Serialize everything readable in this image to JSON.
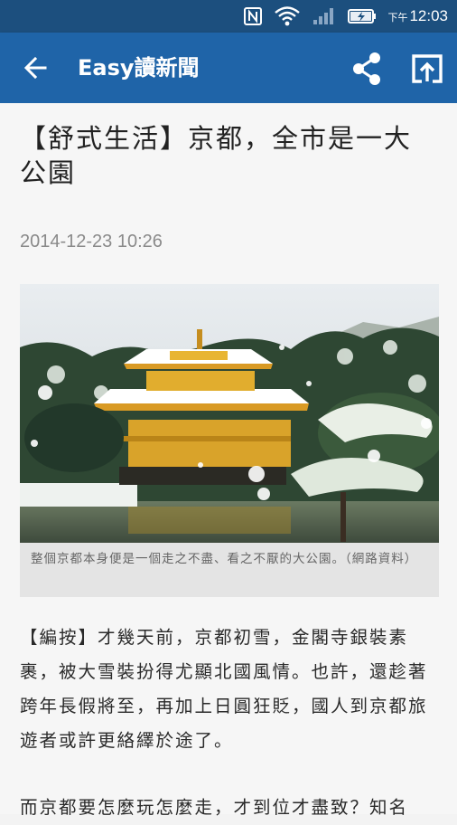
{
  "status_bar": {
    "ampm": "下午",
    "time": "12:03",
    "icons": [
      "nfc-icon",
      "wifi-icon",
      "signal-icon",
      "battery-charging-icon"
    ]
  },
  "app_bar": {
    "title": "Easy讀新聞",
    "back_icon": "arrow-back-icon",
    "share_icon": "share-icon",
    "open_icon": "open-external-icon",
    "color": "#1f64a8"
  },
  "article": {
    "title": "【舒式生活】京都，全市是一大公園",
    "date": "2014-12-23 10:26",
    "image_alt": "snow-covered golden pavilion temple by a pond",
    "caption": "整個京都本身便是一個走之不盡、看之不厭的大公園。（網路資料）",
    "paragraph1": "【編按】才幾天前，京都初雪，金閣寺銀裝素裹，被大雪裝扮得尤顯北國風情。也許，還趁著跨年長假將至，再加上日圓狂貶，國人到京都旅遊者或許更絡繹於途了。",
    "paragraph2": "而京都要怎麼玩怎麼走，才到位才盡致？知名"
  }
}
